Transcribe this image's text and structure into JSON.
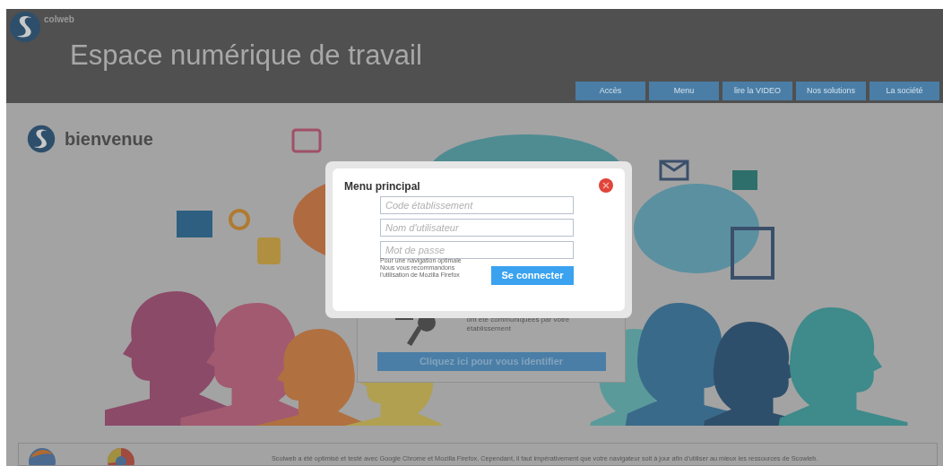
{
  "header": {
    "logo_text": "colweb",
    "title": "Espace numérique de travail",
    "nav": [
      {
        "label": "Accès"
      },
      {
        "label": "Menu"
      },
      {
        "label": "lire la VIDEO"
      },
      {
        "label": "Nos solutions"
      },
      {
        "label": "La société"
      }
    ]
  },
  "welcome": {
    "title": "bienvenue"
  },
  "login_card": {
    "text": "ont été communiquées par votre établissement",
    "button": "Cliquez ici pour vous identifier"
  },
  "modal": {
    "title": "Menu principal",
    "fields": [
      {
        "placeholder": "Code établissement"
      },
      {
        "placeholder": "Nom d'utilisateur"
      },
      {
        "placeholder": "Mot de passe"
      }
    ],
    "note": [
      "Pour une navigation optimale",
      "Nous vous recommandons",
      "l'utilisation de Mozilla Firefox"
    ],
    "button": "Se connecter"
  },
  "footer": {
    "text": "Scolweb a été optimisé et testé avec Google Chrome et Mozilla Firefox. Cependant, il faut impérativement que votre navigateur soit à jour afin d'utiliser au mieux les ressources de Scowleb."
  }
}
